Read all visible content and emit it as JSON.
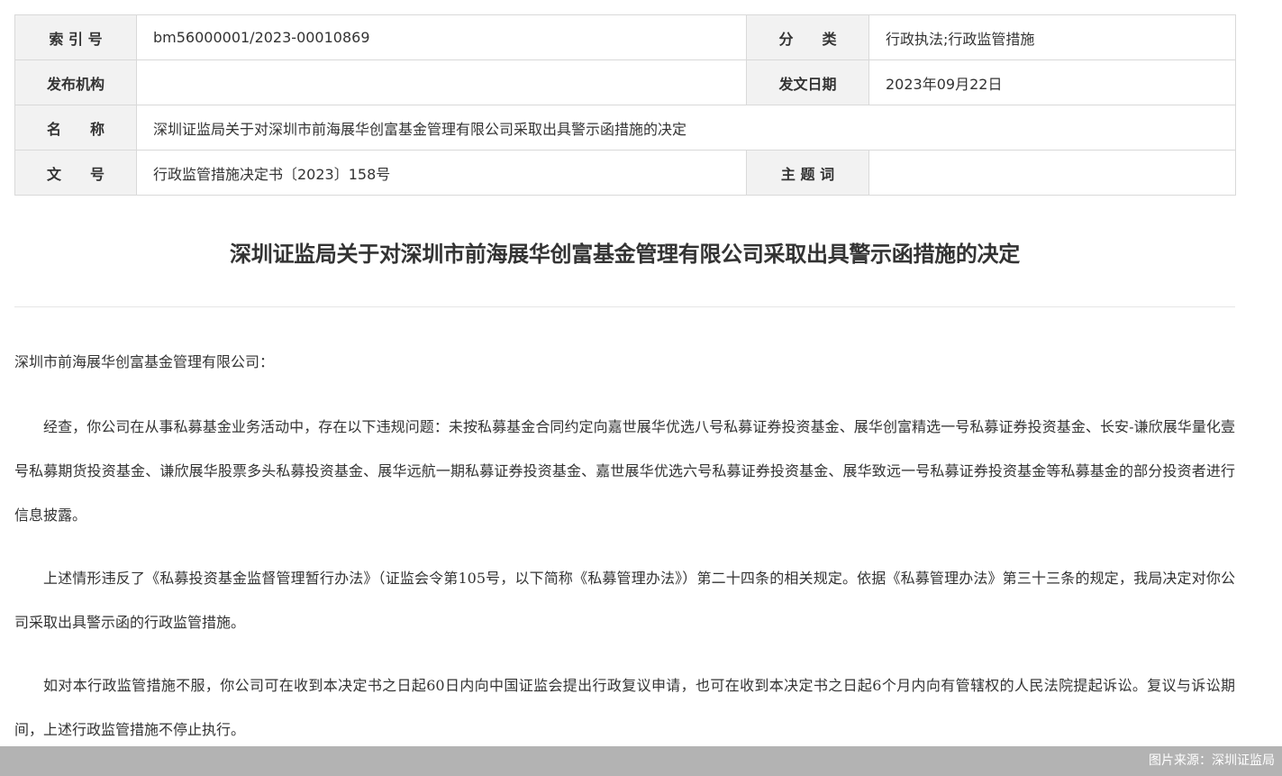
{
  "meta": {
    "index_label": "索 引 号",
    "index_value": "bm56000001/2023-00010869",
    "category_label": "分　　类",
    "category_value": "行政执法;行政监管措施",
    "publisher_label": "发布机构",
    "publisher_value": "",
    "date_label": "发文日期",
    "date_value": "2023年09月22日",
    "name_label": "名　　称",
    "name_value": "深圳证监局关于对深圳市前海展华创富基金管理有限公司采取出具警示函措施的决定",
    "docno_label": "文　　号",
    "docno_value": "行政监管措施决定书〔2023〕158号",
    "keywords_label": "主 题 词",
    "keywords_value": ""
  },
  "document": {
    "title": "深圳证监局关于对深圳市前海展华创富基金管理有限公司采取出具警示函措施的决定",
    "salutation": "深圳市前海展华创富基金管理有限公司：",
    "paragraph_1": "经查，你公司在从事私募基金业务活动中，存在以下违规问题：未按私募基金合同约定向嘉世展华优选八号私募证券投资基金、展华创富精选一号私募证券投资基金、长安-谦欣展华量化壹号私募期货投资基金、谦欣展华股票多头私募投资基金、展华远航一期私募证券投资基金、嘉世展华优选六号私募证券投资基金、展华致远一号私募证券投资基金等私募基金的部分投资者进行信息披露。",
    "paragraph_2": "上述情形违反了《私募投资基金监督管理暂行办法》（证监会令第105号，以下简称《私募管理办法》）第二十四条的相关规定。依据《私募管理办法》第三十三条的规定，我局决定对你公司采取出具警示函的行政监管措施。",
    "paragraph_3": "如对本行政监管措施不服，你公司可在收到本决定书之日起60日内向中国证监会提出行政复议申请，也可在收到本决定书之日起6个月内向有管辖权的人民法院提起诉讼。复议与诉讼期间，上述行政监管措施不停止执行。"
  },
  "footer": {
    "source": "图片来源：深圳证监局"
  }
}
